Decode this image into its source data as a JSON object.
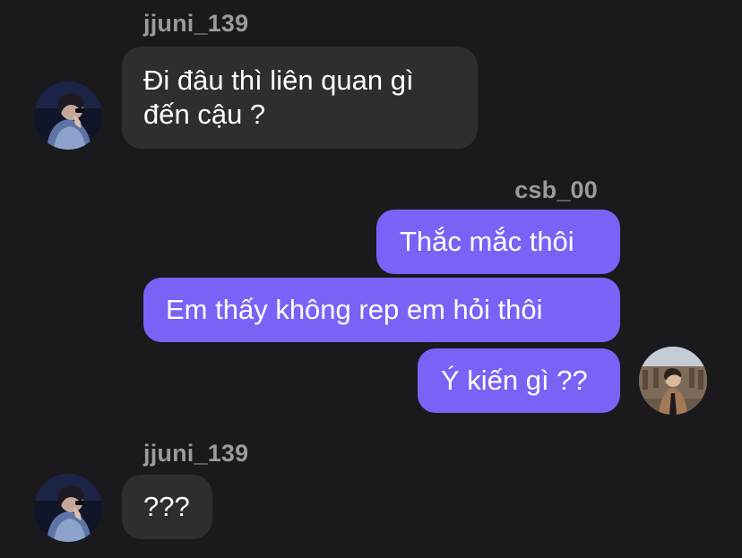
{
  "colors": {
    "background": "#1a191c",
    "incoming_bubble": "#2e2d31",
    "outgoing_bubble": "#7b62f7",
    "username": "#9b9a9e",
    "text": "#ffffff"
  },
  "conversation": {
    "groups": [
      {
        "sender": "jjuni_139",
        "direction": "incoming",
        "avatar_icon": "profile-photo-icon",
        "messages": [
          "Đi đâu thì liên quan gì",
          "đến cậu ?"
        ]
      },
      {
        "sender": "csb_00",
        "direction": "outgoing",
        "avatar_icon": "profile-photo-icon",
        "messages": [
          "Thắc mắc thôi",
          "Em thấy không rep em hỏi thôi",
          "Ý kiến gì ??"
        ]
      },
      {
        "sender": "jjuni_139",
        "direction": "incoming",
        "avatar_icon": "profile-photo-icon",
        "messages": [
          "???"
        ]
      }
    ]
  }
}
